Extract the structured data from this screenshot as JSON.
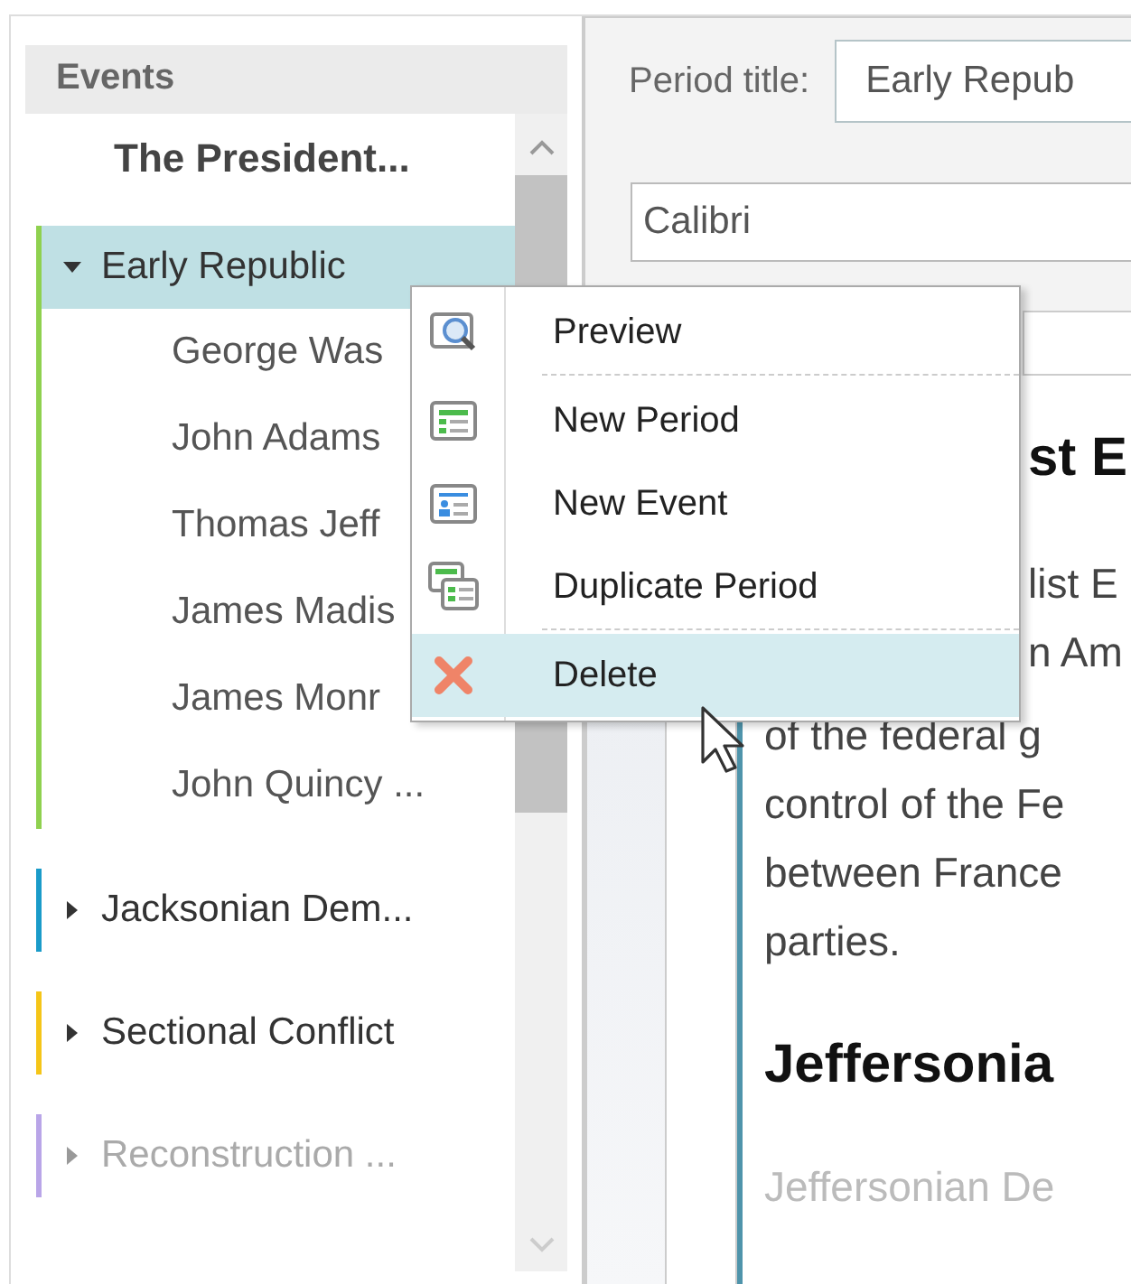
{
  "sidebar": {
    "header": "Events",
    "root": "The President...",
    "periods": [
      {
        "label": "Early Republic",
        "color": "#8fd14f",
        "expanded": true,
        "selected": true,
        "disabled": false,
        "children": [
          {
            "label": "George Was"
          },
          {
            "label": "John Adams"
          },
          {
            "label": "Thomas Jeff"
          },
          {
            "label": "James Madis"
          },
          {
            "label": "James Monr"
          },
          {
            "label": "John Quincy ..."
          }
        ]
      },
      {
        "label": "Jacksonian Dem...",
        "color": "#1a9bc9",
        "expanded": false,
        "selected": false,
        "disabled": false
      },
      {
        "label": "Sectional Conflict",
        "color": "#f5c518",
        "expanded": false,
        "selected": false,
        "disabled": false
      },
      {
        "label": "Reconstruction ...",
        "color": "#b9a5e8",
        "expanded": false,
        "selected": false,
        "disabled": true
      }
    ]
  },
  "editor": {
    "period_title_label": "Period title:",
    "period_title_value": "Early Repub",
    "font_value": "Calibri",
    "document": [
      {
        "kind": "heading",
        "text": "st E"
      },
      {
        "kind": "line",
        "text": "list E"
      },
      {
        "kind": "line",
        "text": "n Am"
      },
      {
        "kind": "line",
        "text": "of the federal g"
      },
      {
        "kind": "line",
        "text": "control of the Fe"
      },
      {
        "kind": "line",
        "text": "between France"
      },
      {
        "kind": "line",
        "text": "parties."
      },
      {
        "kind": "heading",
        "text": "Jeffersonia"
      },
      {
        "kind": "faded",
        "text": "Jeffersonian De"
      }
    ]
  },
  "context_menu": [
    {
      "label": "Preview",
      "kind": "preview",
      "selected": false,
      "divider_after": true
    },
    {
      "label": "New Period",
      "kind": "period",
      "selected": false,
      "divider_after": false
    },
    {
      "label": "New Event",
      "kind": "event",
      "selected": false,
      "divider_after": false
    },
    {
      "label": "Duplicate Period",
      "kind": "duplicate",
      "selected": false,
      "divider_after": true
    },
    {
      "label": "Delete",
      "kind": "delete",
      "selected": true,
      "divider_after": false
    }
  ]
}
